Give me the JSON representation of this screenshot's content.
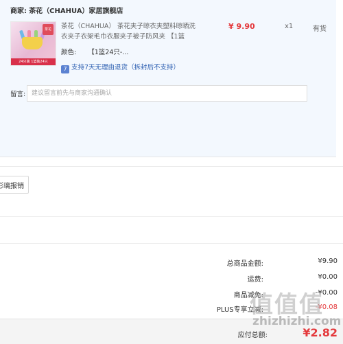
{
  "order": {
    "merchant_label": "商家:",
    "merchant_name": "茶花（CHAHUA）家居旗舰店",
    "product": {
      "title": "茶花（CHAHUA） 茶花夹子晾衣夹塑料晾晒洗衣夹子衣架毛巾衣服夹子被子防风夹 【1篮",
      "color_label": "颜色:",
      "color_value": "【1篮24只-...",
      "return_icon": "7",
      "return_text": "支持7天无理由退货（拆封后不支持）",
      "price": "¥ 9.90",
      "quantity": "x1",
      "stock": "有货",
      "thumb": {
        "badge": "茶花",
        "strip": "24只装 1篮装24只"
      }
    },
    "remark": {
      "label": "留言:",
      "placeholder": "建议留言前先与商家沟通确认"
    }
  },
  "invoice_button_label": "彩璃报销",
  "summary": {
    "rows": [
      {
        "label": "总商品金额:",
        "value": "¥9.90"
      },
      {
        "label": "运费:",
        "value": "¥0.00"
      },
      {
        "label": "商品减免:",
        "value": "-¥0.00"
      },
      {
        "label": "PLUS专享立减:",
        "value": "-¥0.08"
      }
    ],
    "payable_label": "应付总额:",
    "payable_value": "¥2.82"
  },
  "watermark": {
    "glyphs": "值值值",
    "url": "zhizhizhi.com"
  },
  "colors": {
    "accent_red": "#e4393c",
    "card_bg": "#f3f8fe",
    "link_blue": "#2a5db0"
  }
}
